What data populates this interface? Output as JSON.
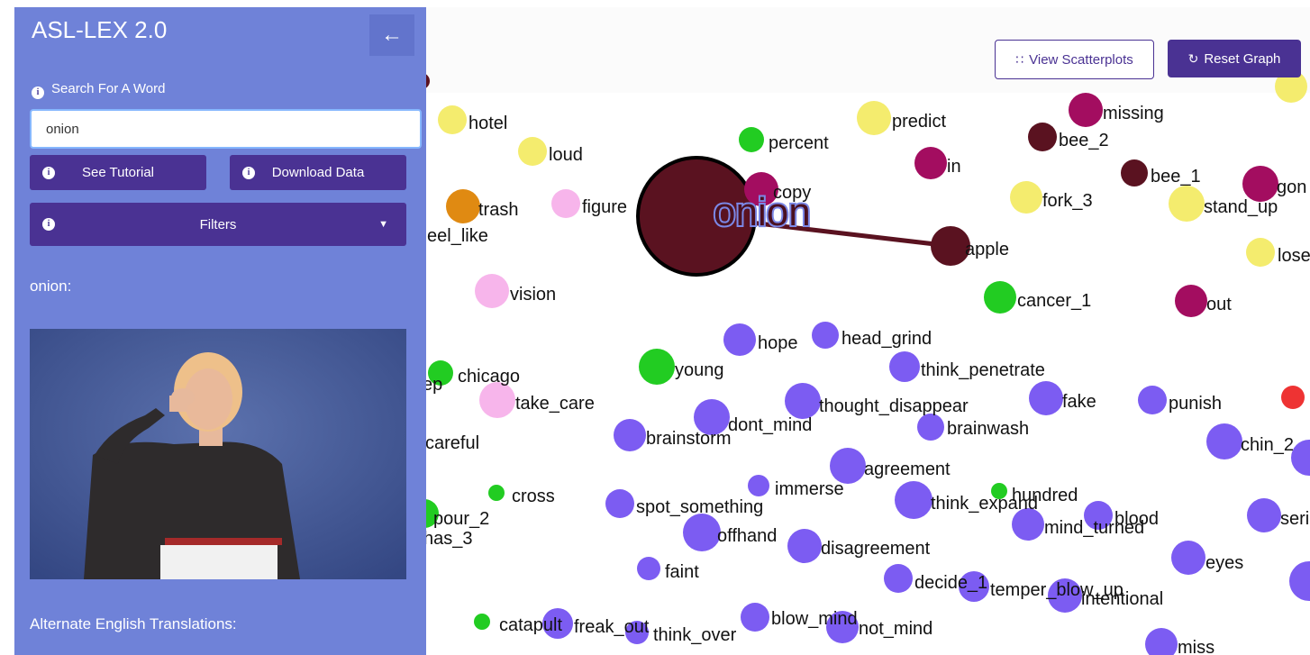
{
  "sidebar": {
    "title": "ASL-LEX 2.0",
    "collapse_icon": "arrow-left-icon",
    "search_label": "Search For A Word",
    "search_value": "onion",
    "tutorial_label": "See Tutorial",
    "download_label": "Download Data",
    "filters_label": "Filters",
    "word_heading": "onion:",
    "alt_translations_label": "Alternate English Translations:"
  },
  "toolbar": {
    "scatter_label": "View Scatterplots",
    "reset_label": "Reset Graph"
  },
  "colors": {
    "sidebar": "#6f82d8",
    "button": "#4a3293",
    "node_purple": "#7c5cf2",
    "node_maroon": "#5a1220",
    "node_magenta": "#a30d60",
    "node_yellow": "#f4ec6e",
    "node_green": "#22cc22",
    "node_pink": "#f7b5eb",
    "node_orange": "#e08a12",
    "node_red": "#ee3333"
  },
  "graph": {
    "focus_word": "onion",
    "nodes": [
      {
        "label": "hotel",
        "color": "yellow"
      },
      {
        "label": "loud",
        "color": "yellow"
      },
      {
        "label": "percent",
        "color": "green"
      },
      {
        "label": "predict",
        "color": "yellow"
      },
      {
        "label": "missing",
        "color": "magenta"
      },
      {
        "label": "bee_2",
        "color": "maroon"
      },
      {
        "label": "in",
        "color": "magenta"
      },
      {
        "label": "bee_1",
        "color": "maroon"
      },
      {
        "label": "gon",
        "color": "magenta"
      },
      {
        "label": "copy",
        "color": "magenta"
      },
      {
        "label": "trash",
        "color": "orange"
      },
      {
        "label": "figure",
        "color": "pink"
      },
      {
        "label": "fork_3",
        "color": "yellow"
      },
      {
        "label": "stand_up",
        "color": "yellow"
      },
      {
        "label": "eel_like",
        "color": "none"
      },
      {
        "label": "apple",
        "color": "maroon"
      },
      {
        "label": "lose",
        "color": "yellow"
      },
      {
        "label": "vision",
        "color": "pink"
      },
      {
        "label": "cancer_1",
        "color": "green"
      },
      {
        "label": "out",
        "color": "magenta"
      },
      {
        "label": "hope",
        "color": "purple"
      },
      {
        "label": "head_grind",
        "color": "purple"
      },
      {
        "label": "young",
        "color": "green"
      },
      {
        "label": "think_penetrate",
        "color": "purple"
      },
      {
        "label": "chicago",
        "color": "green"
      },
      {
        "label": "ep",
        "color": "none"
      },
      {
        "label": "take_care",
        "color": "pink"
      },
      {
        "label": "thought_disappear",
        "color": "purple"
      },
      {
        "label": "fake",
        "color": "purple"
      },
      {
        "label": "punish",
        "color": "purple"
      },
      {
        "label": "dont_mind",
        "color": "purple"
      },
      {
        "label": "brainwash",
        "color": "purple"
      },
      {
        "label": "brainstorm",
        "color": "purple"
      },
      {
        "label": "careful",
        "color": "none"
      },
      {
        "label": "chin_2",
        "color": "purple"
      },
      {
        "label": "agreement",
        "color": "purple"
      },
      {
        "label": "immerse",
        "color": "purple"
      },
      {
        "label": "hundred",
        "color": "green"
      },
      {
        "label": "cross",
        "color": "green"
      },
      {
        "label": "think_expand",
        "color": "purple"
      },
      {
        "label": "spot_something",
        "color": "purple"
      },
      {
        "label": "pour_2",
        "color": "green"
      },
      {
        "label": "blood",
        "color": "purple"
      },
      {
        "label": "mind_turned",
        "color": "purple"
      },
      {
        "label": "seri",
        "color": "purple"
      },
      {
        "label": "has_3",
        "color": "none"
      },
      {
        "label": "offhand",
        "color": "purple"
      },
      {
        "label": "disagreement",
        "color": "purple"
      },
      {
        "label": "eyes",
        "color": "purple"
      },
      {
        "label": "faint",
        "color": "purple"
      },
      {
        "label": "decide_1",
        "color": "purple"
      },
      {
        "label": "temper_blow_up",
        "color": "purple"
      },
      {
        "label": "intentional",
        "color": "purple"
      },
      {
        "label": "blow_mind",
        "color": "purple"
      },
      {
        "label": "catapult",
        "color": "green"
      },
      {
        "label": "freak_out",
        "color": "purple"
      },
      {
        "label": "think_over",
        "color": "purple"
      },
      {
        "label": "not_mind",
        "color": "purple"
      },
      {
        "label": "miss",
        "color": "purple"
      }
    ]
  }
}
